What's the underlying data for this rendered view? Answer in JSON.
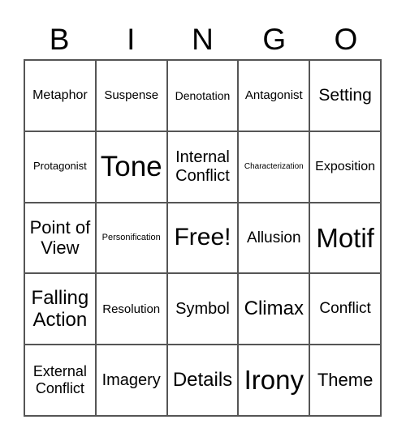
{
  "header": {
    "letters": [
      "B",
      "I",
      "N",
      "G",
      "O"
    ]
  },
  "card": {
    "rows": [
      [
        "Metaphor",
        "Suspense",
        "Denotation",
        "Antagonist",
        "Setting"
      ],
      [
        "Protagonist",
        "Tone",
        "Internal Conflict",
        "Characterization",
        "Exposition"
      ],
      [
        "Point of View",
        "Personification",
        "Free!",
        "Allusion",
        "Motif"
      ],
      [
        "Falling Action",
        "Resolution",
        "Symbol",
        "Climax",
        "Conflict"
      ],
      [
        "External Conflict",
        "Imagery",
        "Details",
        "Irony",
        "Theme"
      ]
    ]
  }
}
